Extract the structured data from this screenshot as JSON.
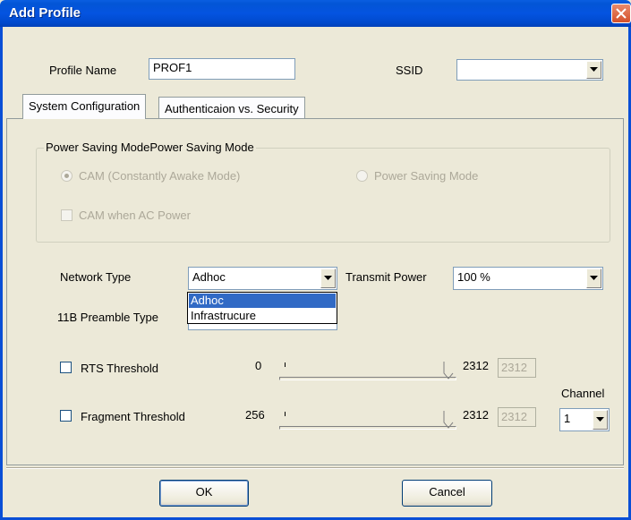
{
  "window": {
    "title": "Add Profile"
  },
  "profile": {
    "name_label": "Profile Name",
    "name_value": "PROF1",
    "ssid_label": "SSID",
    "ssid_value": ""
  },
  "tabs": [
    {
      "label": "System Configuration"
    },
    {
      "label": "Authenticaion vs. Security"
    }
  ],
  "power_saving": {
    "group_title": "Power Saving ModePower Saving Mode",
    "cam_label": "CAM (Constantly Awake Mode)",
    "psm_label": "Power Saving Mode",
    "cam_ac_label": "CAM when AC Power",
    "selected": "CAM (Constantly Awake Mode)"
  },
  "network": {
    "type_label": "Network Type",
    "type_value": "Adhoc",
    "type_options": [
      "Adhoc",
      "Infrastrucure"
    ],
    "transmit_label": "Transmit Power",
    "transmit_value": "100 %",
    "preamble_label": "11B Preamble Type"
  },
  "rts": {
    "label": "RTS Threshold",
    "min": "0",
    "max": "2312",
    "value": "2312"
  },
  "fragment": {
    "label": "Fragment Threshold",
    "min": "256",
    "max": "2312",
    "value": "2312"
  },
  "channel": {
    "label": "Channel",
    "value": "1"
  },
  "buttons": {
    "ok": "OK",
    "cancel": "Cancel"
  },
  "colors": {
    "titlebar": "#0454e0",
    "selection": "#316ac5",
    "dialog_bg": "#ece9d8"
  }
}
